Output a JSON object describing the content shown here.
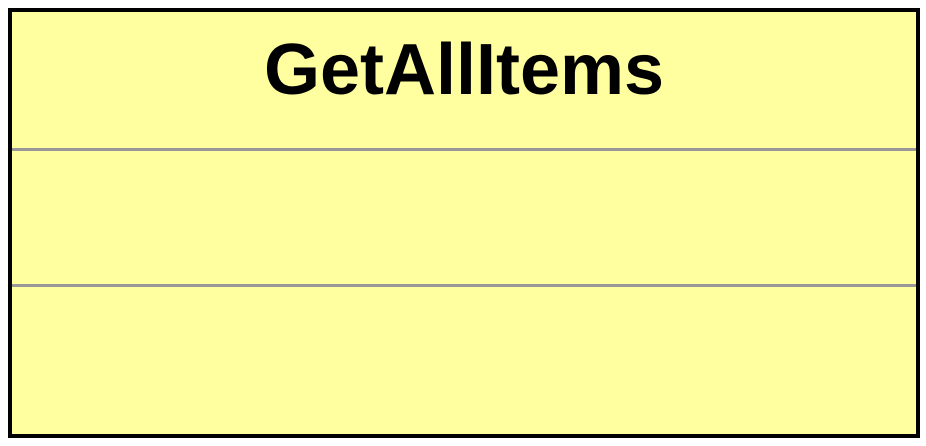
{
  "class_box": {
    "name": "GetAllItems",
    "fill_color": "#ffffa0",
    "border_color": "#000000",
    "divider_color": "#999999",
    "attributes": [],
    "operations": []
  }
}
